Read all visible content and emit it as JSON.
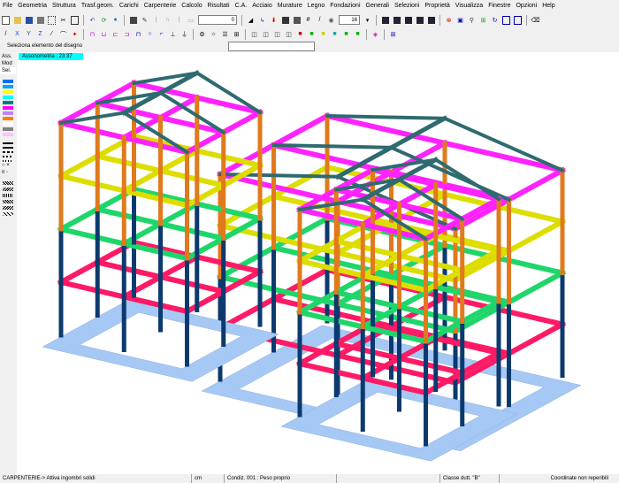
{
  "menu": [
    "File",
    "Geometria",
    "Struttura",
    "Trasf.geom.",
    "Carichi",
    "Carpenterie",
    "Calcolo",
    "Risultati",
    "C.A.",
    "Acciaio",
    "Murature",
    "Legno",
    "Fondazioni",
    "Generali",
    "Selezioni",
    "Proprietà",
    "Visualizza",
    "Finestre",
    "Opzioni",
    "Help"
  ],
  "toolbar": {
    "zoom_value": "16",
    "text_field": "0"
  },
  "prompt": {
    "label": "Seleziona  elemento del disegno"
  },
  "sidebar": {
    "ass": "Ass.",
    "mod": "Mod",
    "sel": "Sel.",
    "sym": "○ ×",
    "sym2": "¤ ◦"
  },
  "sidebar_colors": [
    "#0070ff",
    "#00a0ff",
    "#ffff00",
    "#00ffff",
    "#008080",
    "#ff00ff",
    "#c080ff",
    "#ff8000",
    "#ffffff",
    "#808080",
    "#ffc0ff"
  ],
  "viewport": {
    "label": "Assonometria :   23  37"
  },
  "status": {
    "mode": "CARPENTERIE-> Attiva ingombri solidi",
    "unit": "cm",
    "load_condition": "Condiz. 001 : Peso proprio",
    "ductility": "Classe dutt.  \"B\"",
    "coords": "Coordinate non reperibili"
  },
  "colors": {
    "foundation": "#a6c8f5",
    "column_blue": "#0b3a6e",
    "column_orange": "#e07a1c",
    "beam_red": "#ff1a66",
    "beam_green": "#1fd66a",
    "beam_yellow": "#dddd00",
    "beam_magenta": "#ff22ff",
    "roof": "#2f6a70"
  }
}
